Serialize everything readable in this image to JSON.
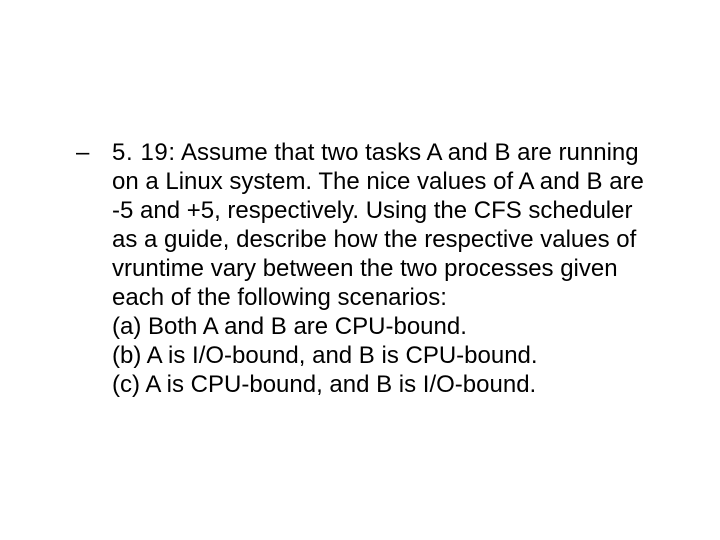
{
  "item": {
    "dash": "–",
    "label": "5. 19:",
    "text": "Assume that two tasks A and B are running on a Linux system. The nice values of A and B are -5 and +5, respectively. Using the CFS scheduler as a guide, describe how the respective values of vruntime vary between the two processes given each of the following scenarios:",
    "scenarios": [
      "(a) Both A and B are CPU-bound.",
      "(b) A is I/O-bound, and B is CPU-bound.",
      "(c) A is CPU-bound, and B is I/O-bound."
    ]
  }
}
